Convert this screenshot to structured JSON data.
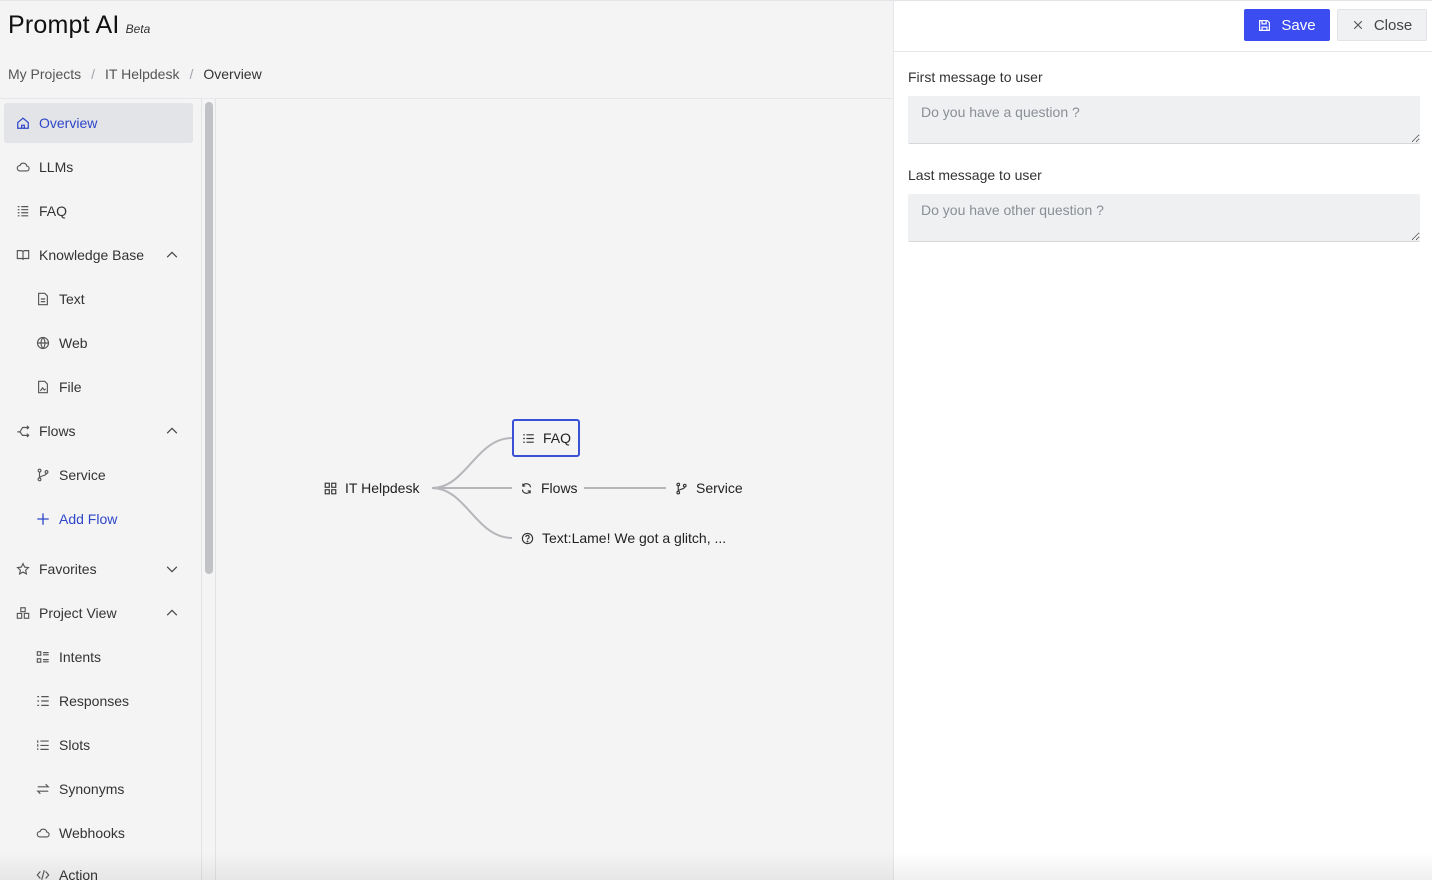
{
  "app": {
    "name": "Prompt AI",
    "badge": "Beta"
  },
  "breadcrumb": [
    "My Projects",
    "IT Helpdesk",
    "Overview"
  ],
  "sidebar": {
    "items": [
      {
        "label": "Overview",
        "icon": "home-icon",
        "active": true
      },
      {
        "label": "LLMs",
        "icon": "cloud-icon"
      },
      {
        "label": "FAQ",
        "icon": "list-icon"
      },
      {
        "label": "Knowledge Base",
        "icon": "book-icon",
        "expanded": true
      },
      {
        "label": "Text",
        "icon": "document-icon"
      },
      {
        "label": "Web",
        "icon": "globe-icon"
      },
      {
        "label": "File",
        "icon": "file-image-icon"
      },
      {
        "label": "Flows",
        "icon": "flows-icon",
        "expanded": true
      },
      {
        "label": "Service",
        "icon": "branch-icon"
      },
      {
        "label": "Add Flow",
        "icon": "plus-icon"
      },
      {
        "label": "Favorites",
        "icon": "star-icon",
        "expanded": false
      },
      {
        "label": "Project View",
        "icon": "cluster-icon",
        "expanded": true
      },
      {
        "label": "Intents",
        "icon": "intents-icon"
      },
      {
        "label": "Responses",
        "icon": "ordered-list-icon"
      },
      {
        "label": "Slots",
        "icon": "slots-icon"
      },
      {
        "label": "Synonyms",
        "icon": "swap-icon"
      },
      {
        "label": "Webhooks",
        "icon": "cloud-icon"
      },
      {
        "label": "Action",
        "icon": "code-icon"
      }
    ]
  },
  "mindmap": {
    "root": "IT Helpdesk",
    "nodes": {
      "faq": "FAQ",
      "flows": "Flows",
      "service": "Service",
      "text": "Text:Lame! We got a glitch, ..."
    },
    "selected": "FAQ"
  },
  "panel": {
    "save_label": "Save",
    "close_label": "Close",
    "first_message_label": "First message to user",
    "first_message_placeholder": "Do you have a question ?",
    "first_message_value": "",
    "last_message_label": "Last message to user",
    "last_message_placeholder": "Do you have other question ?",
    "last_message_value": ""
  },
  "colors": {
    "accent": "#3b4cf0",
    "active_text": "#2e46c8",
    "selected_node_border": "#3851d6"
  }
}
